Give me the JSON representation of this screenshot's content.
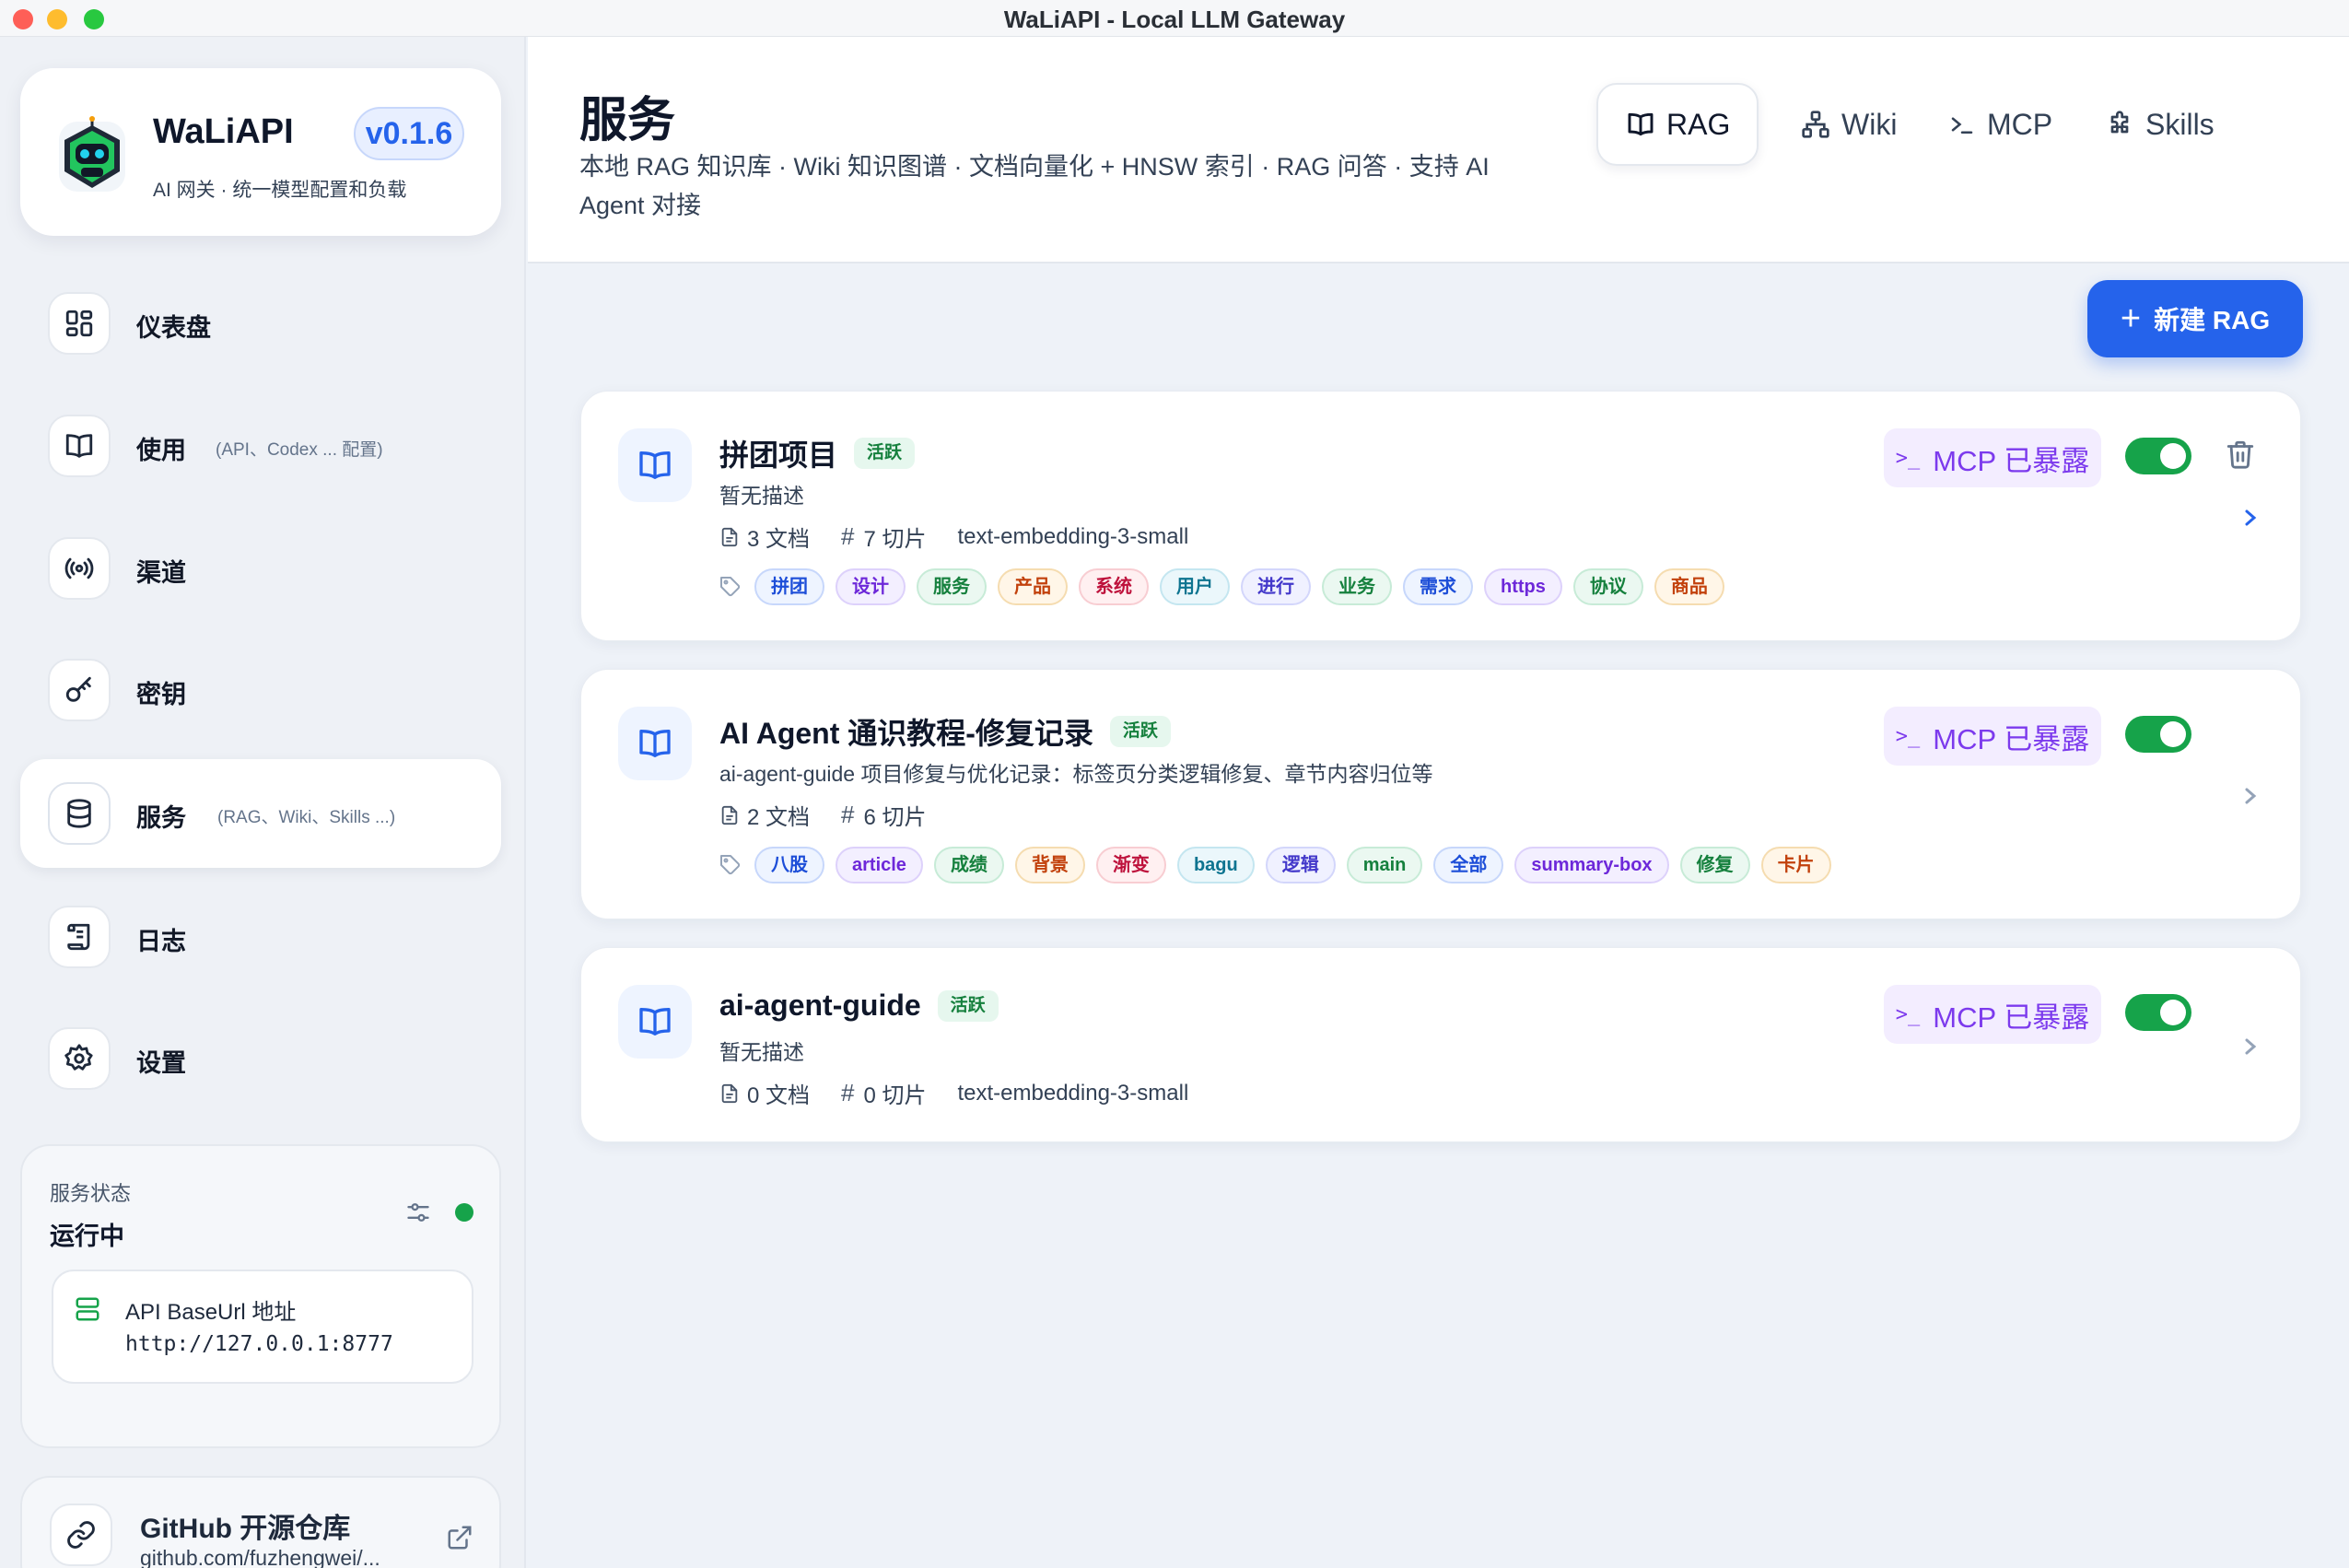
{
  "window": {
    "title": "WaLiAPI - Local LLM Gateway"
  },
  "brand": {
    "name": "WaLiAPI",
    "version": "v0.1.6",
    "subtitle": "AI 网关 · 统一模型配置和负载"
  },
  "nav": [
    {
      "label": "仪表盘",
      "hint": "",
      "icon": "dashboard-icon"
    },
    {
      "label": "使用",
      "hint": "(API、Codex ... 配置)",
      "icon": "book-icon"
    },
    {
      "label": "渠道",
      "hint": "",
      "icon": "broadcast-icon"
    },
    {
      "label": "密钥",
      "hint": "",
      "icon": "key-icon"
    },
    {
      "label": "服务",
      "hint": "(RAG、Wiki、Skills ...)",
      "icon": "database-icon",
      "active": true
    },
    {
      "label": "日志",
      "hint": "",
      "icon": "scroll-icon"
    },
    {
      "label": "设置",
      "hint": "",
      "icon": "gear-icon"
    }
  ],
  "status": {
    "label": "服务状态",
    "value": "运行中",
    "api_label": "API BaseUrl 地址",
    "api_url": "http://127.0.0.1:8777",
    "dot_color": "#16a34a"
  },
  "github": {
    "title": "GitHub 开源仓库",
    "url": "github.com/fuzhengwei/..."
  },
  "page": {
    "title": "服务",
    "subtitle": "本地 RAG 知识库 · Wiki 知识图谱 · 文档向量化 + HNSW 索引 · RAG 问答 · 支持 AI Agent 对接"
  },
  "tabs": [
    {
      "label": "RAG",
      "icon": "book-icon",
      "active": true
    },
    {
      "label": "Wiki",
      "icon": "sitemap-icon"
    },
    {
      "label": "MCP",
      "icon": "terminal-icon"
    },
    {
      "label": "Skills",
      "icon": "puzzle-icon"
    }
  ],
  "new_button": {
    "label": "新建 RAG"
  },
  "rag_items": [
    {
      "name": "拼团项目",
      "status": "活跃",
      "description": "暂无描述",
      "docs": "3 文档",
      "chunks": "7 切片",
      "model": "text-embedding-3-small",
      "mcp_label": "MCP 已暴露",
      "enabled": true,
      "tags": [
        {
          "text": "拼团",
          "color": "blue"
        },
        {
          "text": "设计",
          "color": "purple"
        },
        {
          "text": "服务",
          "color": "green"
        },
        {
          "text": "产品",
          "color": "orange"
        },
        {
          "text": "系统",
          "color": "red"
        },
        {
          "text": "用户",
          "color": "cyan"
        },
        {
          "text": "进行",
          "color": "indigo"
        },
        {
          "text": "业务",
          "color": "green"
        },
        {
          "text": "需求",
          "color": "blue"
        },
        {
          "text": "https",
          "color": "purple"
        },
        {
          "text": "协议",
          "color": "green"
        },
        {
          "text": "商品",
          "color": "orange"
        }
      ]
    },
    {
      "name": "AI Agent 通识教程-修复记录",
      "status": "活跃",
      "description": "ai-agent-guide 项目修复与优化记录：标签页分类逻辑修复、章节内容归位等",
      "docs": "2 文档",
      "chunks": "6 切片",
      "model": "",
      "mcp_label": "MCP 已暴露",
      "enabled": true,
      "tags": [
        {
          "text": "八股",
          "color": "blue"
        },
        {
          "text": "article",
          "color": "purple"
        },
        {
          "text": "成绩",
          "color": "green"
        },
        {
          "text": "背景",
          "color": "orange"
        },
        {
          "text": "渐变",
          "color": "red"
        },
        {
          "text": "bagu",
          "color": "cyan"
        },
        {
          "text": "逻辑",
          "color": "indigo"
        },
        {
          "text": "main",
          "color": "green"
        },
        {
          "text": "全部",
          "color": "blue"
        },
        {
          "text": "summary-box",
          "color": "purple"
        },
        {
          "text": "修复",
          "color": "green"
        },
        {
          "text": "卡片",
          "color": "orange"
        }
      ]
    },
    {
      "name": "ai-agent-guide",
      "status": "活跃",
      "description": "暂无描述",
      "docs": "0 文档",
      "chunks": "0 切片",
      "model": "text-embedding-3-small",
      "mcp_label": "MCP 已暴露",
      "enabled": true,
      "tags": []
    }
  ],
  "colors": {
    "accent": "#2563eb",
    "mcp": "#7c3aed",
    "toggle_on": "#16a34a"
  }
}
